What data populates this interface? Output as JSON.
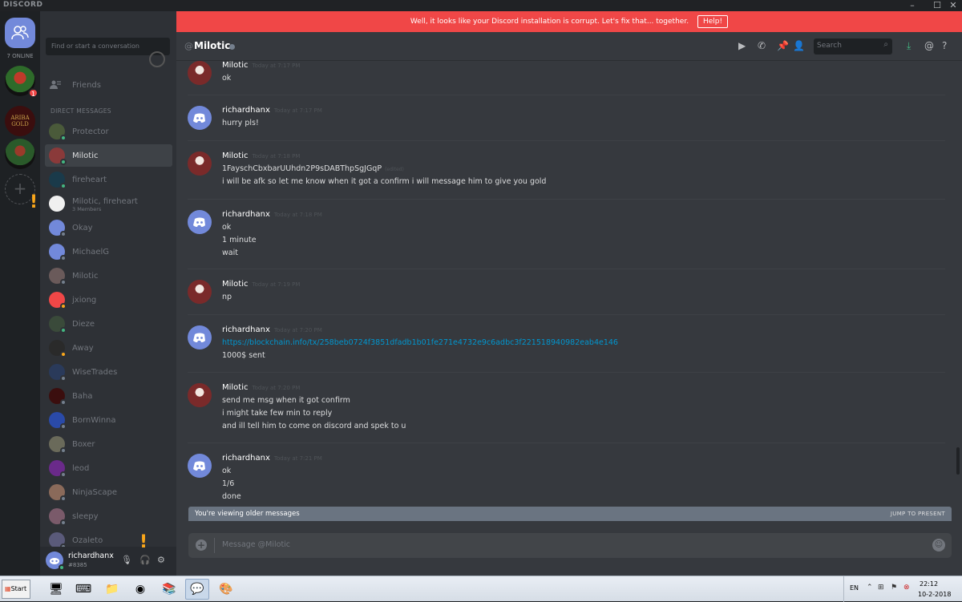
{
  "titlebar": {
    "app_name": "DISCORD",
    "min": "–",
    "max": "☐",
    "close": "✕"
  },
  "guilds": {
    "online_label": "7 ONLINE",
    "items": [
      {
        "badge": "1",
        "color": "#2e6b2a"
      },
      {
        "label": "ARIBA GOLD",
        "color": "#3b0e0e"
      },
      {
        "color": "#2a5a2a"
      }
    ],
    "add_label": "+"
  },
  "dm": {
    "search_placeholder": "Find or start a conversation",
    "friends_label": "Friends",
    "header": "DIRECT MESSAGES",
    "items": [
      {
        "name": "Protector",
        "status": "online",
        "color": "#4a5a3a"
      },
      {
        "name": "Milotic",
        "status": "online",
        "color": "#8a3a3a"
      },
      {
        "name": "fireheart",
        "status": "online",
        "color": "#1a3a4a"
      },
      {
        "name": "Milotic, fireheart",
        "sub": "3 Members",
        "status": "",
        "color": "#f0f0f0"
      },
      {
        "name": "Okay",
        "status": "offline",
        "color": "#7289da"
      },
      {
        "name": "MichaelG",
        "status": "offline",
        "color": "#7289da"
      },
      {
        "name": "Milotic",
        "status": "offline",
        "color": "#6a5a5a"
      },
      {
        "name": "jxiong",
        "status": "idle",
        "color": "#f04747"
      },
      {
        "name": "Dieze",
        "status": "online",
        "color": "#3a4a3a"
      },
      {
        "name": "Away",
        "status": "idle",
        "color": "#2a2a2a"
      },
      {
        "name": "WiseTrades",
        "status": "offline",
        "color": "#2a3a5a"
      },
      {
        "name": "Baha",
        "status": "offline",
        "color": "#3b0e0e"
      },
      {
        "name": "BornWinna",
        "status": "offline",
        "color": "#2a4aa8"
      },
      {
        "name": "Boxer",
        "status": "offline",
        "color": "#6a6a5a"
      },
      {
        "name": "leod",
        "status": "offline",
        "color": "#6a2a8a"
      },
      {
        "name": "NinjaScape",
        "status": "offline",
        "color": "#8a6a5a"
      },
      {
        "name": "sleepy",
        "status": "offline",
        "color": "#7a5a6a"
      },
      {
        "name": "Ozaleto",
        "status": "offline",
        "color": "#5a5a7a"
      }
    ]
  },
  "user": {
    "name": "richardhanx",
    "discriminator": "#8385"
  },
  "banner": {
    "text": "Well, it looks like your Discord installation is corrupt. Let's fix that... together.",
    "button": "Help!"
  },
  "channel": {
    "at": "@",
    "name": "Milotic",
    "search_placeholder": "Search"
  },
  "messages": [
    {
      "author": "Milotic",
      "time": "Today at 7:17 PM",
      "avatar": "milotic",
      "lines": [
        "ok"
      ]
    },
    {
      "author": "richardhanx",
      "time": "Today at 7:17 PM",
      "avatar": "discord",
      "lines": [
        "hurry pls!"
      ]
    },
    {
      "author": "Milotic",
      "time": "Today at 7:18 PM",
      "avatar": "milotic",
      "lines": [
        "1FayschCbxbarUUhdn2P9sDABThpSgJGqP",
        "i will be afk so let me know when it got a confirm i will message him to give you gold"
      ],
      "edited": "(edited)"
    },
    {
      "author": "richardhanx",
      "time": "Today at 7:18 PM",
      "avatar": "discord",
      "lines": [
        "ok",
        "1 minute",
        "wait"
      ]
    },
    {
      "author": "Milotic",
      "time": "Today at 7:19 PM",
      "avatar": "milotic",
      "lines": [
        "np"
      ]
    },
    {
      "author": "richardhanx",
      "time": "Today at 7:20 PM",
      "avatar": "discord",
      "lines": [
        "https://blockchain.info/tx/258beb0724f3851dfadb1b01fe271e4732e9c6adbc3f221518940982eab4e146",
        "1000$ sent"
      ],
      "link_index": 0
    },
    {
      "author": "Milotic",
      "time": "Today at 7:20 PM",
      "avatar": "milotic",
      "lines": [
        "send me msg when it got confirm",
        "i might take few min to reply",
        "and ill tell him to come on discord and spek to u"
      ]
    },
    {
      "author": "richardhanx",
      "time": "Today at 7:21 PM",
      "avatar": "discord",
      "lines": [
        "ok",
        "1/6",
        "done"
      ]
    }
  ],
  "older_bar": {
    "text": "You're viewing older messages",
    "jump": "JUMP TO PRESENT"
  },
  "composer": {
    "placeholder": "Message @Milotic"
  },
  "taskbar": {
    "start": "Start",
    "lang": "EN",
    "time": "22:12",
    "date": "10-2-2018",
    "tray_badge": "1"
  },
  "colors": {
    "accent": "#7289da",
    "danger": "#f04747",
    "online": "#43b581",
    "idle": "#faa61a",
    "offline": "#747f8d"
  }
}
